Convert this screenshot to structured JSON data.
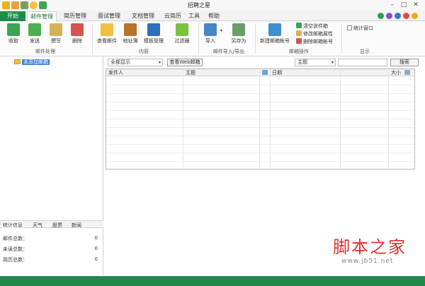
{
  "app": {
    "title": "招聘之星"
  },
  "quick_access": [
    "star-icon",
    "user-icon",
    "print-icon",
    "smile-icon",
    "refresh-icon"
  ],
  "menu_tabs": [
    "开始",
    "邮件管理",
    "简历管理",
    "面试管理",
    "文档管理",
    "云简历",
    "工具",
    "帮助"
  ],
  "theme_colors": [
    "#2e9e4f",
    "#8a4fbf",
    "#3b6fd8",
    "#e24a3b",
    "#f2a51a"
  ],
  "ribbon": {
    "mail_handle": {
      "label": "邮件处理",
      "buttons": [
        "收取",
        "发送",
        "撰写",
        "删除"
      ]
    },
    "content": {
      "label": "内容",
      "buttons": [
        "查看邮件",
        "地址簿",
        "模板管理",
        "过滤器"
      ]
    },
    "import_export": {
      "label": "邮件导入/导出",
      "buttons": [
        "导入",
        "另存为"
      ]
    },
    "mailbox_ops": {
      "label": "邮箱操作",
      "main_button": "新建邮箱帐号",
      "small_buttons": [
        "清空该件箱",
        "修改邮箱属性",
        "删除邮箱帐号"
      ]
    },
    "display": {
      "label": "显示",
      "checkbox": "统计窗口",
      "checked": false
    }
  },
  "tree": {
    "item": "未添加邮箱"
  },
  "stats": {
    "tabs": [
      "统计信息",
      "天气",
      "股票",
      "新闻"
    ],
    "rows": [
      {
        "label": "邮件总数：",
        "value": "0"
      },
      {
        "label": "未读总数：",
        "value": "0"
      },
      {
        "label": "简历总数：",
        "value": "0"
      }
    ]
  },
  "filter": {
    "display": "全部显示",
    "web_button": "查看Web邮箱",
    "search_field": "主题",
    "search_button": "搜索"
  },
  "maillist": {
    "columns": [
      "发件人",
      "主题",
      "日期",
      "大小"
    ]
  },
  "watermark": {
    "main": "脚本之家",
    "sub": "www.jb51.net"
  }
}
